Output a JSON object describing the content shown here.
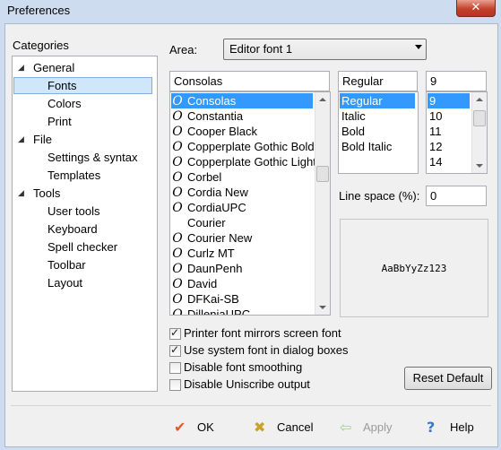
{
  "window": {
    "title": "Preferences",
    "close_glyph": "✕"
  },
  "categories": {
    "label": "Categories",
    "tree": [
      {
        "label": "General",
        "expander": "◢",
        "selected": false
      },
      {
        "label": "Fonts",
        "selected": true
      },
      {
        "label": "Colors"
      },
      {
        "label": "Print"
      },
      {
        "label": "File",
        "expander": "◢"
      },
      {
        "label": "Settings & syntax"
      },
      {
        "label": "Templates"
      },
      {
        "label": "Tools",
        "expander": "◢"
      },
      {
        "label": "User tools"
      },
      {
        "label": "Keyboard"
      },
      {
        "label": "Spell checker"
      },
      {
        "label": "Toolbar"
      },
      {
        "label": "Layout"
      }
    ]
  },
  "area": {
    "label": "Area:",
    "value": "Editor font 1"
  },
  "font_family": {
    "value": "Consolas",
    "list": [
      {
        "name": "Consolas",
        "icon": "O",
        "selected": true
      },
      {
        "name": "Constantia",
        "icon": "O"
      },
      {
        "name": "Cooper Black",
        "icon": "O"
      },
      {
        "name": "Copperplate Gothic Bold",
        "icon": "O"
      },
      {
        "name": "Copperplate Gothic Light",
        "icon": "O"
      },
      {
        "name": "Corbel",
        "icon": "O"
      },
      {
        "name": "Cordia New",
        "icon": "O"
      },
      {
        "name": "CordiaUPC",
        "icon": "O"
      },
      {
        "name": "Courier",
        "icon": ""
      },
      {
        "name": "Courier New",
        "icon": "O"
      },
      {
        "name": "Curlz MT",
        "icon": "O"
      },
      {
        "name": "DaunPenh",
        "icon": "O"
      },
      {
        "name": "David",
        "icon": "O"
      },
      {
        "name": "DFKai-SB",
        "icon": "O"
      },
      {
        "name": "DilleniaUPC",
        "icon": "O"
      }
    ]
  },
  "font_style": {
    "value": "Regular",
    "list": [
      {
        "name": "Regular",
        "selected": true
      },
      {
        "name": "Italic"
      },
      {
        "name": "Bold"
      },
      {
        "name": "Bold Italic"
      }
    ]
  },
  "font_size": {
    "value": "9",
    "list": [
      {
        "name": "9",
        "selected": true
      },
      {
        "name": "10"
      },
      {
        "name": "11"
      },
      {
        "name": "12"
      },
      {
        "name": "14"
      }
    ]
  },
  "line_space": {
    "label": "Line space (%):",
    "value": "0"
  },
  "preview": {
    "text": "AaBbYyZz123"
  },
  "options": [
    {
      "label": "Printer font mirrors screen font",
      "checked": true
    },
    {
      "label": "Use system font in dialog boxes",
      "checked": true
    },
    {
      "label": "Disable font smoothing",
      "checked": false
    },
    {
      "label": "Disable Uniscribe output",
      "checked": false
    }
  ],
  "reset_default_label": "Reset Default",
  "buttons": {
    "ok": {
      "label": "OK",
      "icon": "✔",
      "color": "#e8572b"
    },
    "cancel": {
      "label": "Cancel",
      "icon": "✖",
      "color": "#c9a227"
    },
    "apply": {
      "label": "Apply",
      "icon": "⇦",
      "color": "#a9c9a0"
    },
    "help": {
      "label": "Help",
      "icon": "?",
      "color": "#3a78c9"
    }
  }
}
